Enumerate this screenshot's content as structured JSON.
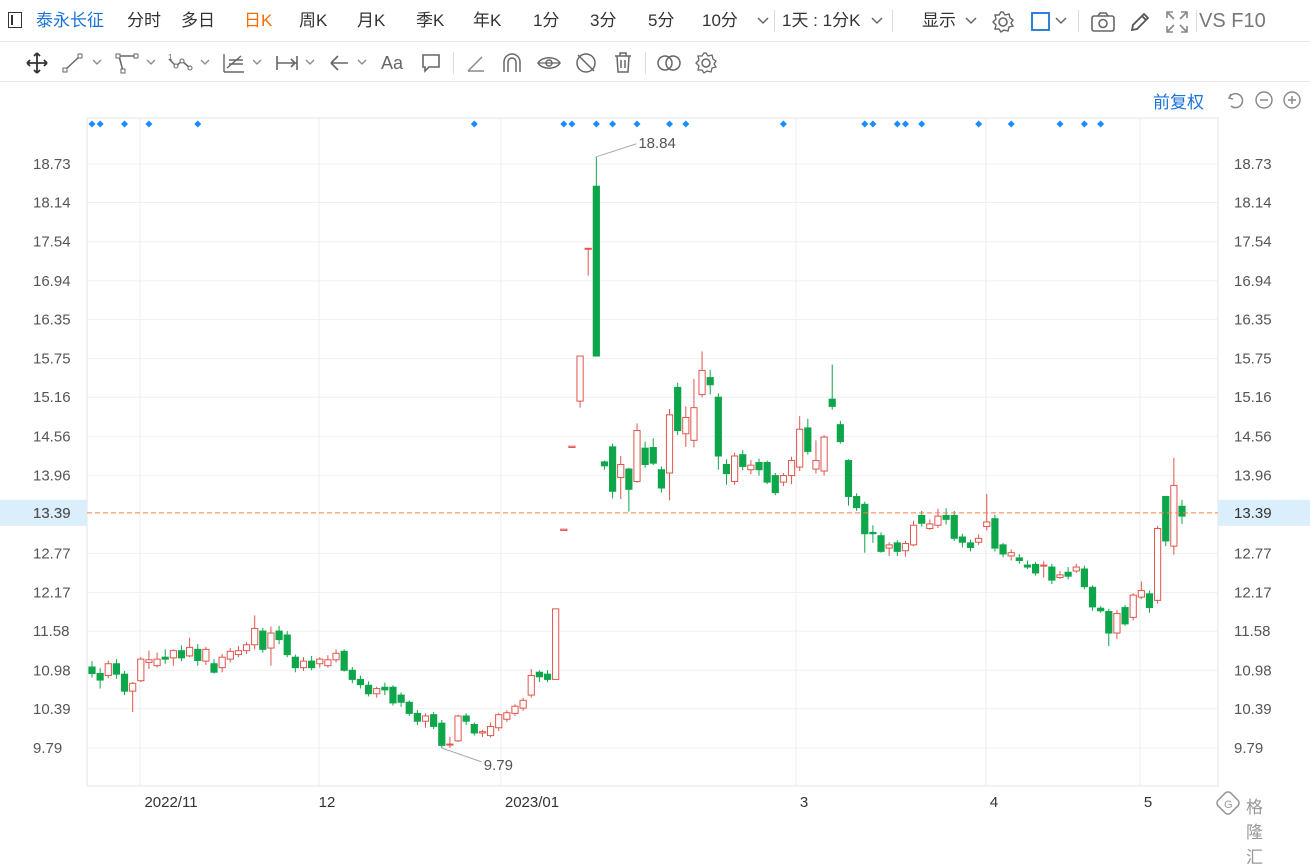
{
  "toolbar": {
    "stock_name": "泰永长征",
    "periods": [
      "分时",
      "多日",
      "日K",
      "周K",
      "月K",
      "季K",
      "年K",
      "1分",
      "3分",
      "5分",
      "10分"
    ],
    "active_period": "日K",
    "interval": "1天 : 1分K",
    "display": "显示",
    "vs_f10": "VS F10"
  },
  "controls": {
    "adjust": "前复权"
  },
  "watermark": "格隆汇",
  "icons": [
    "cursor-icon",
    "crosshair-move-icon",
    "line-tool-icon",
    "trend-angle-icon",
    "path-icon",
    "fib-icon",
    "measure-icon",
    "arrow-icon",
    "text-icon",
    "comment-icon",
    "ruler-icon",
    "magnet-icon",
    "eye-icon",
    "hide-icon",
    "trash-icon",
    "compare-icon",
    "settings-icon",
    "camera-icon",
    "pencil-icon",
    "fullscreen-icon"
  ],
  "colors": {
    "up": "#e0554d",
    "down": "#0ea64a",
    "last_price": "#ff7f50",
    "accent": "#1a73d9"
  },
  "chart_data": {
    "type": "candlestick",
    "price_axis_labels": [
      "18.73",
      "18.14",
      "17.54",
      "16.94",
      "16.35",
      "15.75",
      "15.16",
      "14.56",
      "13.96",
      "13.39",
      "12.77",
      "12.17",
      "11.58",
      "10.98",
      "10.39",
      "9.79"
    ],
    "date_axis_labels": [
      "2022/11",
      "12",
      "2023/01",
      "3",
      "4",
      "5"
    ],
    "ylim": [
      9.4,
      19.15
    ],
    "high_label": "18.84",
    "low_label": "9.79",
    "last_price": "13.39",
    "candles": [
      [
        11.03,
        10.93,
        11.12,
        10.87
      ],
      [
        10.93,
        10.83,
        11.01,
        10.7
      ],
      [
        10.9,
        11.08,
        11.13,
        10.86
      ],
      [
        11.08,
        10.92,
        11.15,
        10.85
      ],
      [
        10.92,
        10.66,
        10.97,
        10.6
      ],
      [
        10.66,
        10.78,
        10.8,
        10.34
      ],
      [
        10.82,
        11.15,
        11.18,
        10.8
      ],
      [
        11.1,
        11.14,
        11.28,
        11.0
      ],
      [
        11.05,
        11.15,
        11.25,
        11.02
      ],
      [
        11.18,
        11.15,
        11.3,
        11.08
      ],
      [
        11.17,
        11.28,
        11.3,
        11.05
      ],
      [
        11.28,
        11.17,
        11.36,
        11.12
      ],
      [
        11.2,
        11.33,
        11.48,
        11.18
      ],
      [
        11.3,
        11.13,
        11.38,
        11.05
      ],
      [
        11.12,
        11.3,
        11.34,
        11.06
      ],
      [
        11.08,
        10.95,
        11.15,
        10.93
      ],
      [
        11.02,
        11.18,
        11.23,
        10.95
      ],
      [
        11.15,
        11.27,
        11.32,
        11.1
      ],
      [
        11.22,
        11.28,
        11.35,
        11.18
      ],
      [
        11.28,
        11.37,
        11.41,
        11.23
      ],
      [
        11.37,
        11.62,
        11.82,
        11.3
      ],
      [
        11.58,
        11.3,
        11.63,
        11.25
      ],
      [
        11.32,
        11.55,
        11.65,
        11.05
      ],
      [
        11.58,
        11.45,
        11.66,
        11.38
      ],
      [
        11.52,
        11.22,
        11.58,
        11.18
      ],
      [
        11.18,
        11.02,
        11.22,
        10.95
      ],
      [
        11.02,
        11.12,
        11.18,
        10.97
      ],
      [
        11.12,
        11.02,
        11.2,
        10.98
      ],
      [
        11.08,
        11.15,
        11.18,
        11.02
      ],
      [
        11.05,
        11.14,
        11.21,
        11.02
      ],
      [
        11.14,
        11.24,
        11.3,
        11.1
      ],
      [
        11.27,
        10.98,
        11.3,
        10.96
      ],
      [
        10.98,
        10.84,
        11.03,
        10.78
      ],
      [
        10.84,
        10.76,
        10.9,
        10.7
      ],
      [
        10.75,
        10.62,
        10.81,
        10.58
      ],
      [
        10.62,
        10.7,
        10.73,
        10.56
      ],
      [
        10.72,
        10.68,
        10.79,
        10.6
      ],
      [
        10.72,
        10.48,
        10.75,
        10.44
      ],
      [
        10.6,
        10.49,
        10.64,
        10.42
      ],
      [
        10.49,
        10.32,
        10.52,
        10.28
      ],
      [
        10.32,
        10.2,
        10.37,
        10.14
      ],
      [
        10.2,
        10.28,
        10.32,
        10.1
      ],
      [
        10.3,
        10.12,
        10.34,
        10.08
      ],
      [
        10.17,
        9.83,
        10.22,
        9.79
      ],
      [
        9.84,
        9.85,
        9.96,
        9.79
      ],
      [
        9.9,
        10.28,
        10.3,
        9.88
      ],
      [
        10.28,
        10.2,
        10.32,
        10.14
      ],
      [
        10.15,
        10.02,
        10.18,
        9.98
      ],
      [
        10.02,
        10.04,
        10.07,
        9.96
      ],
      [
        9.98,
        10.12,
        10.18,
        9.95
      ],
      [
        10.1,
        10.3,
        10.33,
        10.05
      ],
      [
        10.23,
        10.33,
        10.37,
        10.19
      ],
      [
        10.32,
        10.43,
        10.46,
        10.28
      ],
      [
        10.4,
        10.52,
        10.56,
        10.36
      ],
      [
        10.6,
        10.9,
        11.0,
        10.56
      ],
      [
        10.95,
        10.88,
        10.98,
        10.8
      ],
      [
        10.92,
        10.84,
        10.98,
        10.8
      ],
      [
        10.84,
        11.92,
        11.92,
        10.84
      ],
      [
        13.12,
        13.14,
        13.14,
        13.12
      ],
      [
        14.39,
        14.41,
        14.41,
        14.39
      ],
      [
        15.1,
        15.79,
        15.79,
        15.0
      ],
      [
        17.44,
        17.44,
        17.44,
        17.02
      ],
      [
        18.39,
        15.79,
        18.84,
        15.79
      ],
      [
        14.17,
        14.11,
        14.19,
        14.05
      ],
      [
        14.4,
        13.72,
        14.45,
        13.61
      ],
      [
        13.93,
        14.13,
        14.26,
        13.6
      ],
      [
        14.06,
        13.75,
        14.08,
        13.41
      ],
      [
        13.87,
        14.65,
        14.76,
        13.85
      ],
      [
        14.38,
        14.13,
        14.48,
        14.08
      ],
      [
        14.39,
        14.15,
        14.53,
        14.12
      ],
      [
        14.05,
        13.77,
        14.1,
        13.7
      ],
      [
        14.0,
        14.89,
        14.98,
        13.58
      ],
      [
        15.31,
        14.65,
        15.38,
        14.58
      ],
      [
        14.6,
        14.85,
        15.02,
        14.4
      ],
      [
        14.5,
        15.0,
        15.44,
        14.39
      ],
      [
        15.2,
        15.57,
        15.86,
        15.16
      ],
      [
        15.46,
        15.35,
        15.58,
        15.2
      ],
      [
        15.16,
        14.26,
        15.22,
        14.05
      ],
      [
        14.13,
        13.99,
        14.21,
        13.82
      ],
      [
        13.87,
        14.26,
        14.31,
        13.82
      ],
      [
        14.28,
        14.1,
        14.35,
        14.04
      ],
      [
        14.05,
        14.12,
        14.2,
        13.98
      ],
      [
        14.16,
        14.05,
        14.22,
        13.96
      ],
      [
        14.16,
        13.86,
        14.19,
        13.83
      ],
      [
        13.96,
        13.7,
        14.0,
        13.66
      ],
      [
        13.86,
        13.96,
        14.0,
        13.8
      ],
      [
        13.96,
        14.19,
        14.25,
        13.83
      ],
      [
        14.09,
        14.67,
        14.87,
        14.03
      ],
      [
        14.69,
        14.33,
        14.83,
        14.28
      ],
      [
        14.06,
        14.19,
        14.5,
        13.99
      ],
      [
        14.03,
        14.55,
        14.58,
        13.96
      ],
      [
        15.13,
        15.02,
        15.66,
        14.97
      ],
      [
        14.74,
        14.48,
        14.8,
        14.45
      ],
      [
        14.19,
        13.64,
        14.21,
        13.5
      ],
      [
        13.64,
        13.47,
        13.69,
        13.42
      ],
      [
        13.52,
        13.07,
        13.56,
        12.78
      ],
      [
        13.09,
        13.07,
        13.2,
        12.93
      ],
      [
        13.04,
        12.8,
        13.09,
        12.78
      ],
      [
        12.85,
        12.9,
        12.94,
        12.73
      ],
      [
        12.93,
        12.8,
        12.97,
        12.73
      ],
      [
        12.81,
        12.92,
        12.96,
        12.72
      ],
      [
        12.9,
        13.2,
        13.27,
        12.88
      ],
      [
        13.35,
        13.23,
        13.42,
        13.18
      ],
      [
        13.15,
        13.22,
        13.29,
        13.13
      ],
      [
        13.2,
        13.34,
        13.45,
        13.16
      ],
      [
        13.35,
        13.29,
        13.46,
        13.21
      ],
      [
        13.35,
        13.0,
        13.42,
        12.96
      ],
      [
        13.02,
        12.94,
        13.07,
        12.86
      ],
      [
        12.93,
        12.86,
        12.98,
        12.8
      ],
      [
        12.94,
        13.0,
        13.06,
        12.9
      ],
      [
        13.18,
        13.25,
        13.68,
        13.12
      ],
      [
        13.3,
        12.85,
        13.36,
        12.8
      ],
      [
        12.9,
        12.76,
        12.93,
        12.71
      ],
      [
        12.73,
        12.78,
        12.83,
        12.66
      ],
      [
        12.7,
        12.66,
        12.76,
        12.61
      ],
      [
        12.59,
        12.56,
        12.66,
        12.53
      ],
      [
        12.6,
        12.47,
        12.64,
        12.43
      ],
      [
        12.59,
        12.59,
        12.65,
        12.4
      ],
      [
        12.56,
        12.36,
        12.61,
        12.3
      ],
      [
        12.4,
        12.44,
        12.5,
        12.38
      ],
      [
        12.48,
        12.42,
        12.56,
        12.37
      ],
      [
        12.5,
        12.56,
        12.61,
        12.47
      ],
      [
        12.53,
        12.26,
        12.58,
        12.22
      ],
      [
        12.25,
        11.95,
        12.28,
        11.89
      ],
      [
        11.93,
        11.89,
        11.96,
        11.86
      ],
      [
        11.88,
        11.55,
        11.92,
        11.35
      ],
      [
        11.55,
        11.85,
        11.9,
        11.46
      ],
      [
        11.94,
        11.69,
        11.98,
        11.66
      ],
      [
        11.79,
        12.13,
        12.16,
        11.74
      ],
      [
        12.1,
        12.2,
        12.34,
        12.07
      ],
      [
        12.15,
        11.94,
        12.2,
        11.86
      ],
      [
        12.05,
        13.15,
        13.19,
        12.0
      ],
      [
        13.64,
        12.96,
        13.65,
        12.88
      ],
      [
        12.88,
        13.81,
        14.23,
        12.75
      ],
      [
        13.49,
        13.34,
        13.59,
        13.22
      ]
    ],
    "event_markers": [
      0,
      1,
      4,
      7,
      13,
      47,
      58,
      59,
      62,
      64,
      67,
      71,
      73,
      85,
      95,
      96,
      99,
      100,
      102,
      109,
      113,
      119,
      122,
      124
    ]
  }
}
